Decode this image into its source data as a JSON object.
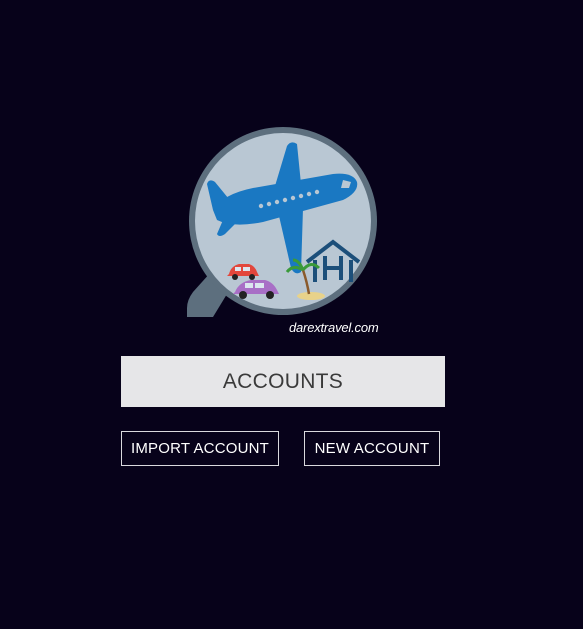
{
  "brand": {
    "logo_icon": "magnifier-travel-logo",
    "caption": "darextravel.com"
  },
  "accounts": {
    "title": "ACCOUNTS"
  },
  "actions": {
    "import_label": "IMPORT ACCOUNT",
    "new_label": "NEW ACCOUNT"
  },
  "colors": {
    "background": "#07021a",
    "title_bg": "#e6e6e8",
    "button_border": "#d9d9de",
    "plane": "#1a78c2",
    "lens": "#b9c7d3",
    "lens_rim": "#5d6f7e"
  }
}
